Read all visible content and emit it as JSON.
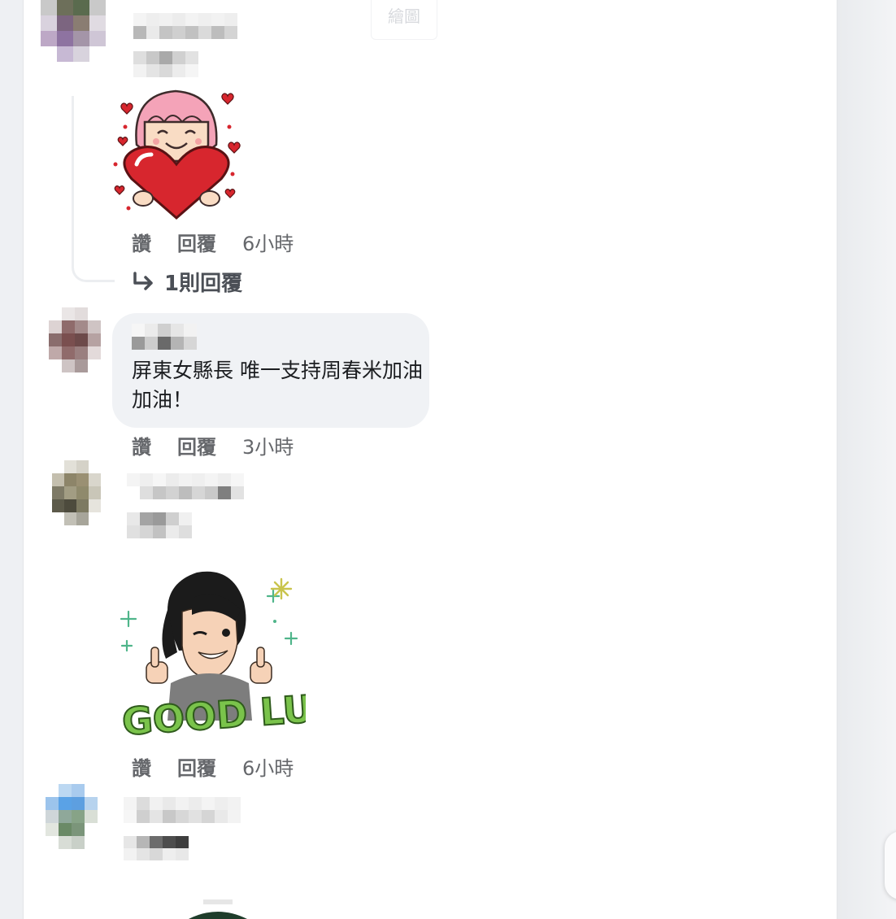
{
  "header": {
    "ghost_button_label": "繪圖"
  },
  "comments": [
    {
      "actions": {
        "like": "讚",
        "reply": "回覆",
        "time": "6小時"
      },
      "replies_label": "1則回覆"
    },
    {
      "text": "屏東女縣長 唯一支持周春米加油加油！",
      "actions": {
        "like": "讚",
        "reply": "回覆",
        "time": "3小時"
      }
    },
    {
      "actions": {
        "like": "讚",
        "reply": "回覆",
        "time": "6小時"
      },
      "sticker_text": "GOOD LUCK"
    }
  ],
  "colors": {
    "panel": "#ffffff",
    "bubble": "#f0f2f5",
    "action_text": "#65676b",
    "page_bg": "#eef0f3"
  }
}
